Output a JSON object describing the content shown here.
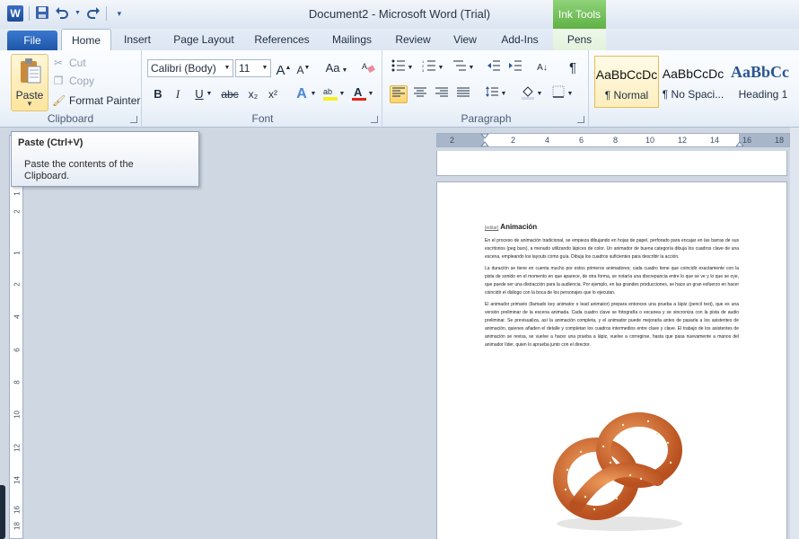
{
  "window": {
    "title": "Document2 - Microsoft Word (Trial)",
    "contextual_tab_header": "Ink Tools"
  },
  "quick_access": {
    "logo": "W",
    "items": [
      "save-icon",
      "undo-icon",
      "redo-icon",
      "customize-icon"
    ]
  },
  "tabs": [
    {
      "label": "File"
    },
    {
      "label": "Home"
    },
    {
      "label": "Insert"
    },
    {
      "label": "Page Layout"
    },
    {
      "label": "References"
    },
    {
      "label": "Mailings"
    },
    {
      "label": "Review"
    },
    {
      "label": "View"
    },
    {
      "label": "Add-Ins"
    },
    {
      "label": "Pens"
    }
  ],
  "active_tab": "Home",
  "clipboard": {
    "group_label": "Clipboard",
    "paste": "Paste",
    "cut": "Cut",
    "copy": "Copy",
    "format_painter": "Format Painter"
  },
  "font": {
    "group_label": "Font",
    "family": "Calibri (Body)",
    "size": "11",
    "grow": "A",
    "shrink": "A",
    "change_case": "Aa",
    "bold": "B",
    "italic": "I",
    "underline": "U",
    "strike": "abc",
    "subscript": "x₂",
    "superscript": "x²"
  },
  "paragraph": {
    "group_label": "Paragraph",
    "show_marks": "¶"
  },
  "styles": [
    {
      "sample": "AaBbCcDc",
      "name": "¶ Normal"
    },
    {
      "sample": "AaBbCcDc",
      "name": "¶ No Spaci..."
    },
    {
      "sample": "AaBbCc",
      "name": "Heading 1"
    }
  ],
  "tooltip": {
    "title": "Paste (Ctrl+V)",
    "body": "Paste the contents of the Clipboard."
  },
  "hruler": {
    "labels": [
      "2",
      "2",
      "4",
      "6",
      "8",
      "10",
      "12",
      "14",
      "16",
      "18"
    ]
  },
  "vruler": {
    "labels": [
      "1",
      "2",
      "1",
      "2",
      "4",
      "6",
      "8",
      "10",
      "12",
      "14",
      "16",
      "18"
    ]
  },
  "document": {
    "heading_tag": "[editar]",
    "heading": "Animación",
    "paragraphs": [
      "En el proceso de animación tradicional, se empieza dibujando en hojas de papel, perforado para encajar en las barras de sus escritorios (peg bars), a menudo utilizando lápices de color. Un animador de buena categoría dibuja los cuadros clave de una escena, empleando los layouts como guía. Dibuja los cuadros suficientes para describir la acción.",
      "La duración se tiene en cuenta mucho por estos primeros animadores; cada cuadro tiene que coincidir exactamente con la pista de sonido en el momento en que aparece, de otra forma, se notaría una discrepancia entre lo que se ve y lo que se oye, que puede ser una distracción para la audiencia. Por ejemplo, en las grandes producciones, se hace un gran esfuerzo en hacer coincidir el diálogo con la boca de los personajes que lo ejecutan.",
      "El animador primario (llamado key animator o lead animator) prepara entonces una prueba a lápiz (pencil test), que es una versión preliminar de la escena animada. Cada cuadro clave se fotografía o escanea y se sincroniza con la pista de audio preliminar. Se previsualiza, así la animación completa, y el animador puede mejorarla antes de pasarla a los asistentes de animación, quienes añaden el detalle y completan los cuadros intermedios entre clave y clave. El trabajo de los asistentes de animación se revisa, se vuelve a hacer una prueba a lápiz, vuelve a corregirse, hasta que pasa nuevamente a manos del animador líder, quien lo aprueba junto con el director."
    ]
  },
  "colors": {
    "file_tab": "#2a67bf",
    "ink_tools": "#6cbd50",
    "pressed": "#fbd36a",
    "page_bg": "#cfd7e2"
  }
}
